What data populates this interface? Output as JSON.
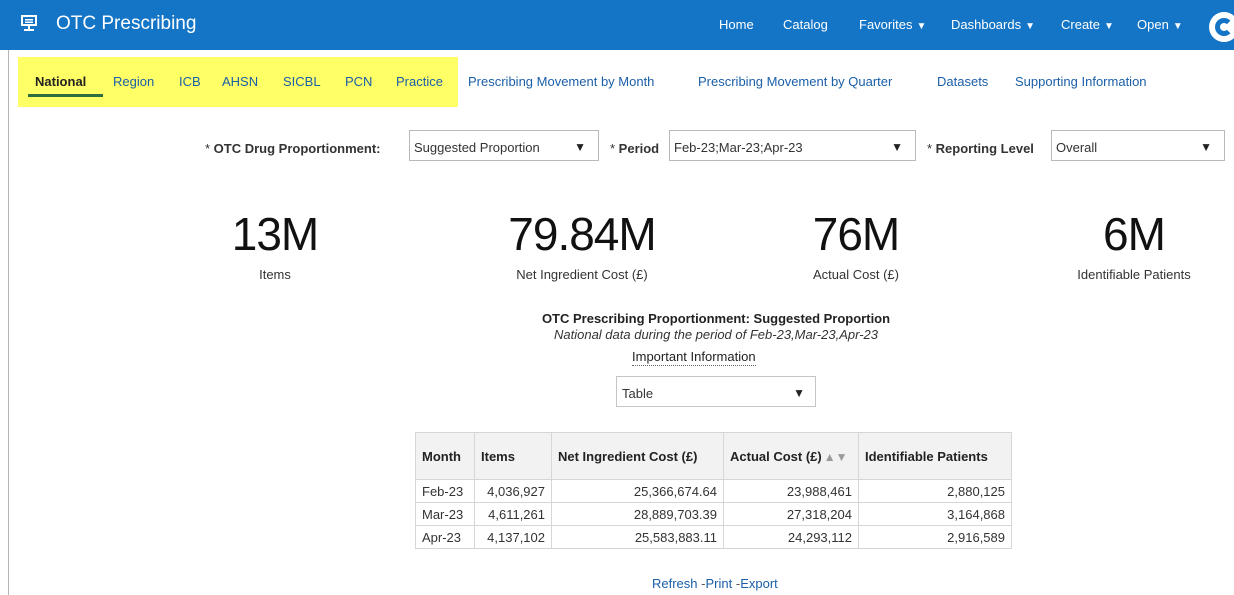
{
  "header": {
    "app_title": "OTC Prescribing",
    "app_icon": "monitor-icon",
    "nav": [
      {
        "label": "Home",
        "dropdown": false
      },
      {
        "label": "Catalog",
        "dropdown": false
      },
      {
        "label": "Favorites",
        "dropdown": true
      },
      {
        "label": "Dashboards",
        "dropdown": true
      },
      {
        "label": "Create",
        "dropdown": true
      },
      {
        "label": "Open",
        "dropdown": true
      }
    ],
    "user_icon": "user-icon",
    "bar_color": "#1475c7"
  },
  "tabs": [
    {
      "label": "National",
      "active": true
    },
    {
      "label": "Region"
    },
    {
      "label": "ICB"
    },
    {
      "label": "AHSN"
    },
    {
      "label": "SICBL"
    },
    {
      "label": "PCN"
    },
    {
      "label": "Practice"
    },
    {
      "label": "Prescribing Movement by Month"
    },
    {
      "label": "Prescribing Movement by Quarter"
    },
    {
      "label": "Datasets"
    },
    {
      "label": "Supporting Information"
    }
  ],
  "highlight_color": "#ffff66",
  "filters": [
    {
      "label": "OTC Drug Proportionment:",
      "value": "Suggested Proportion"
    },
    {
      "label": "Period",
      "value": "Feb-23;Mar-23;Apr-23"
    },
    {
      "label": "Reporting Level",
      "value": "Overall"
    }
  ],
  "kpis": [
    {
      "value": "13M",
      "label": "Items"
    },
    {
      "value": "79.84M",
      "label": "Net Ingredient Cost (£)"
    },
    {
      "value": "76M",
      "label": "Actual Cost (£)"
    },
    {
      "value": "6M",
      "label": "Identifiable Patients"
    }
  ],
  "report": {
    "title": "OTC Prescribing Proportionment: Suggested Proportion",
    "subtitle": "National data during the period of Feb-23,Mar-23,Apr-23",
    "info_link": "Important Information",
    "view_selector": "Table"
  },
  "table": {
    "columns": [
      "Month",
      "Items",
      "Net Ingredient Cost (£)",
      "Actual Cost (£)",
      "Identifiable Patients"
    ],
    "rows": [
      [
        "Feb-23",
        "4,036,927",
        "25,366,674.64",
        "23,988,461",
        "2,880,125"
      ],
      [
        "Mar-23",
        "4,611,261",
        "28,889,703.39",
        "27,318,204",
        "3,164,868"
      ],
      [
        "Apr-23",
        "4,137,102",
        "25,583,883.11",
        "24,293,112",
        "2,916,589"
      ]
    ]
  },
  "footer_links": {
    "refresh": "Refresh",
    "print": "Print",
    "export": "Export"
  }
}
